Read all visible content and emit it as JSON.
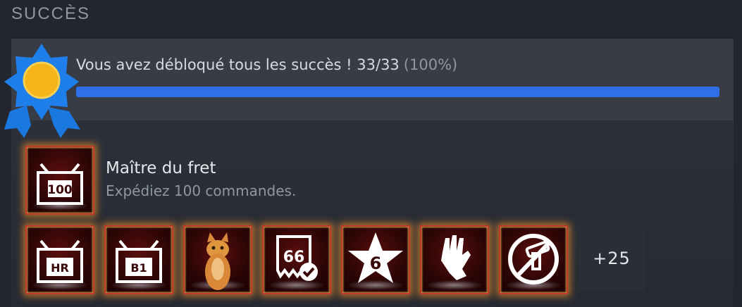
{
  "section": {
    "title": "SUCCÈS"
  },
  "summary": {
    "text": "Vous avez débloqué tous les succès ! 33/33",
    "percent_text": "(100%)",
    "unlocked": 33,
    "total": 33,
    "progress_fraction": 1.0
  },
  "featured": {
    "name": "Maître du fret",
    "description": "Expédiez 100 commandes.",
    "icon_label": "100"
  },
  "tiles": [
    {
      "icon": "crate-hr-icon",
      "label": "HR"
    },
    {
      "icon": "crate-b1-icon",
      "label": "B1"
    },
    {
      "icon": "cat-icon",
      "label": ""
    },
    {
      "icon": "receipt-66-icon",
      "label": "66"
    },
    {
      "icon": "star-6-icon",
      "label": "6"
    },
    {
      "icon": "glove-icon",
      "label": ""
    },
    {
      "icon": "no-scanner-icon",
      "label": ""
    }
  ],
  "more": {
    "label": "+25"
  },
  "colors": {
    "background": "#23262e",
    "accent_blue": "#2f6fe8",
    "tile_border": "#c0392b",
    "tile_glow": "#e68c28"
  }
}
